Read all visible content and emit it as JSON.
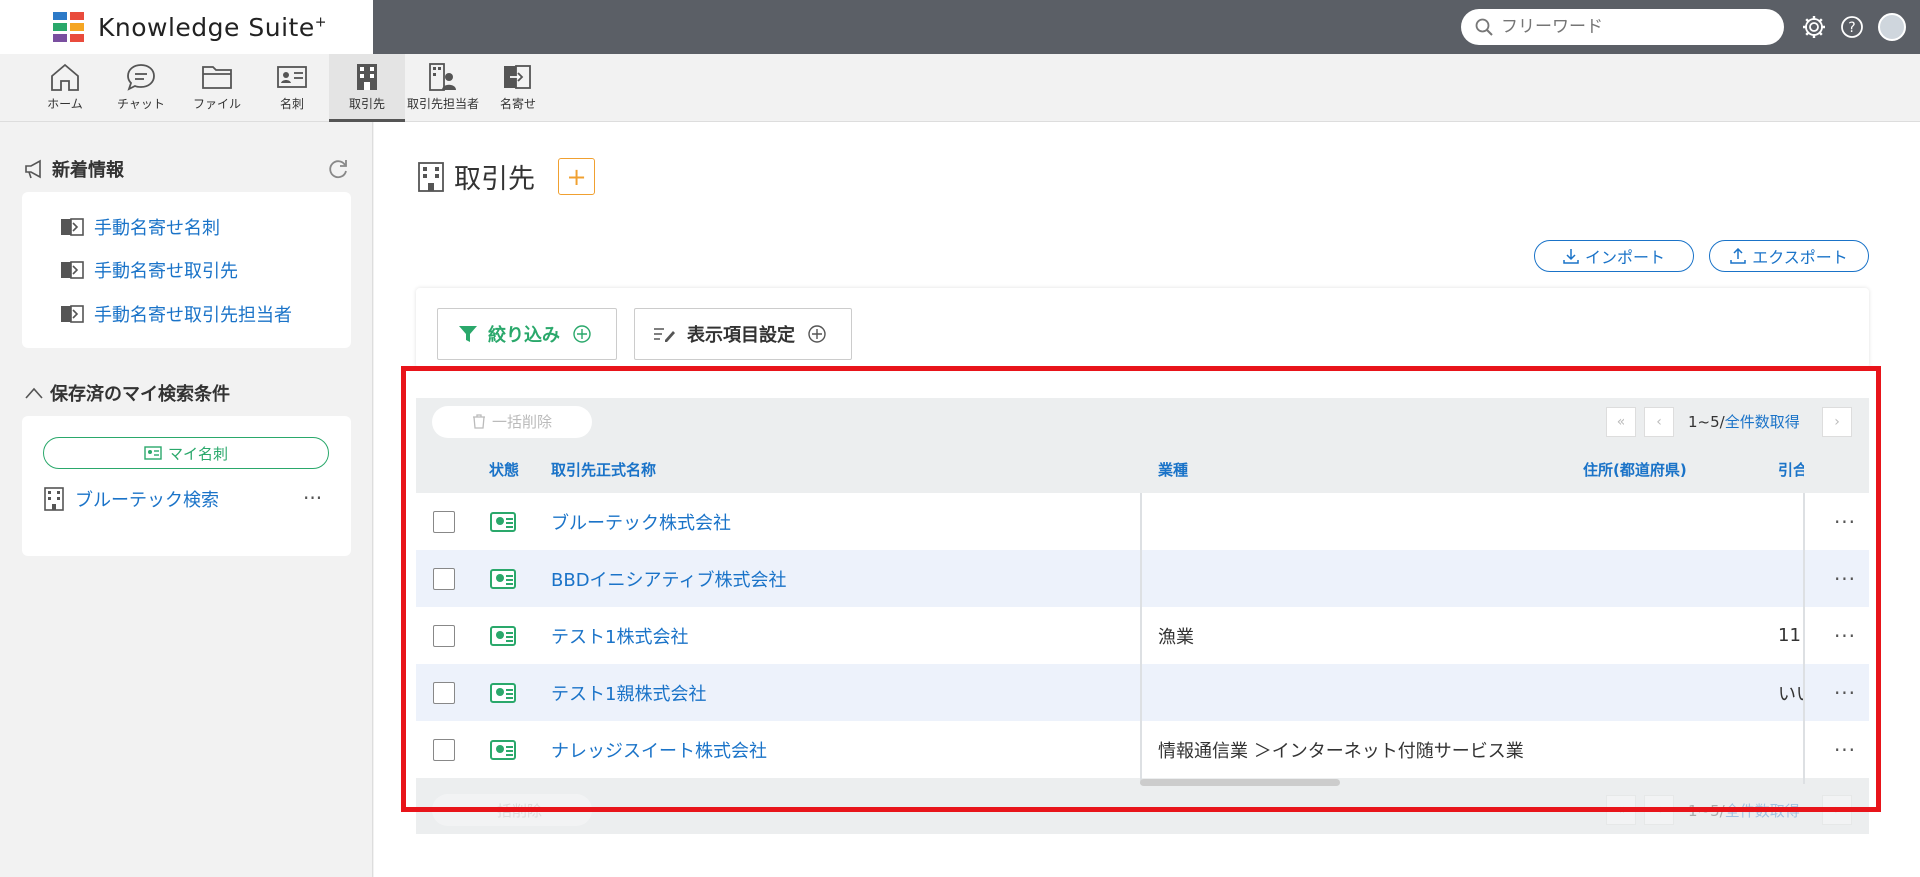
{
  "app": {
    "brand": "Knowledge Suite",
    "brand_sup": "+",
    "logo_colors": [
      "#e94b3c",
      "#2aa86b",
      "#2c7ac8",
      "#f5a623",
      "#7a4fa0",
      "#e94b3c"
    ]
  },
  "header": {
    "search_placeholder": "フリーワード"
  },
  "nav": {
    "items": [
      {
        "label": "ホーム",
        "icon": "home-icon"
      },
      {
        "label": "チャット",
        "icon": "chat-icon"
      },
      {
        "label": "ファイル",
        "icon": "folder-icon"
      },
      {
        "label": "名刺",
        "icon": "business-card-icon"
      },
      {
        "label": "取引先",
        "icon": "building-icon",
        "active": true
      },
      {
        "label": "取引先担当者",
        "icon": "building-person-icon"
      },
      {
        "label": "名寄せ",
        "icon": "merge-icon"
      }
    ]
  },
  "sidebar": {
    "news_title": "新着情報",
    "news_links": [
      "手動名寄せ名刺",
      "手動名寄せ取引先",
      "手動名寄せ取引先担当者"
    ],
    "saved_title": "保存済のマイ検索条件",
    "my_card_label": "マイ名刺",
    "saved_items": [
      "ブルーテック検索"
    ],
    "more_label": "···"
  },
  "main": {
    "title": "取引先",
    "add_label": "+",
    "import_label": "インポート",
    "export_label": "エクスポート",
    "filter_label": "絞り込み",
    "columns_label": "表示項目設定"
  },
  "table": {
    "bulk_delete": "一括削除",
    "pager_range": "1~5/",
    "pager_total": "全件数取得",
    "headers": {
      "status": "状態",
      "name": "取引先正式名称",
      "industry": "業種",
      "prefecture": "住所(都道府県)",
      "next": "引合"
    },
    "rows": [
      {
        "name": "ブルーテック株式会社",
        "industry": "",
        "prefecture": ""
      },
      {
        "name": "BBDイニシアティブ株式会社",
        "industry": "",
        "prefecture": ""
      },
      {
        "name": "テスト1株式会社",
        "industry": "漁業",
        "prefecture": "11"
      },
      {
        "name": "テスト1親株式会社",
        "industry": "",
        "prefecture": "いい"
      },
      {
        "name": "ナレッジスイート株式会社",
        "industry": "情報通信業 ＞インターネット付随サービス業",
        "prefecture": ""
      }
    ],
    "row_more": "···"
  },
  "highlight_color": "#e8141a"
}
